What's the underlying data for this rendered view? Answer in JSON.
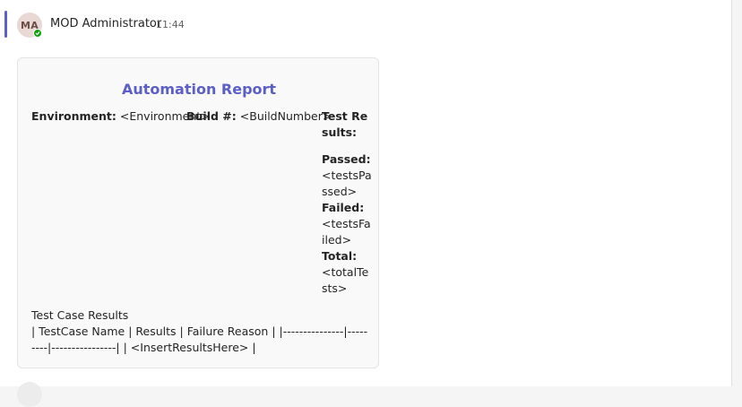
{
  "message": {
    "avatar_initials": "MA",
    "sender": "MOD Administrator",
    "time": "11:44",
    "presence_color": "#13a10e",
    "accent_color": "#5b5fc7"
  },
  "card": {
    "title": "Automation Report",
    "environment_label": "Environment:",
    "environment_value": "<Environment>",
    "build_label": "Build #:",
    "build_value": "<BuildNumber>",
    "test_results_label": "Test Results:",
    "passed_label": "Passed:",
    "passed_value": "<testsPassed>",
    "failed_label": "Failed:",
    "failed_value": "<testsFailed>",
    "total_label": "Total:",
    "total_value": "<totalTests>",
    "table_heading": "Test Case Results",
    "table_markdown": "| TestCase Name | Results | Failure Reason | |---------------|---------|----------------| | <InsertResultsHere> |"
  }
}
